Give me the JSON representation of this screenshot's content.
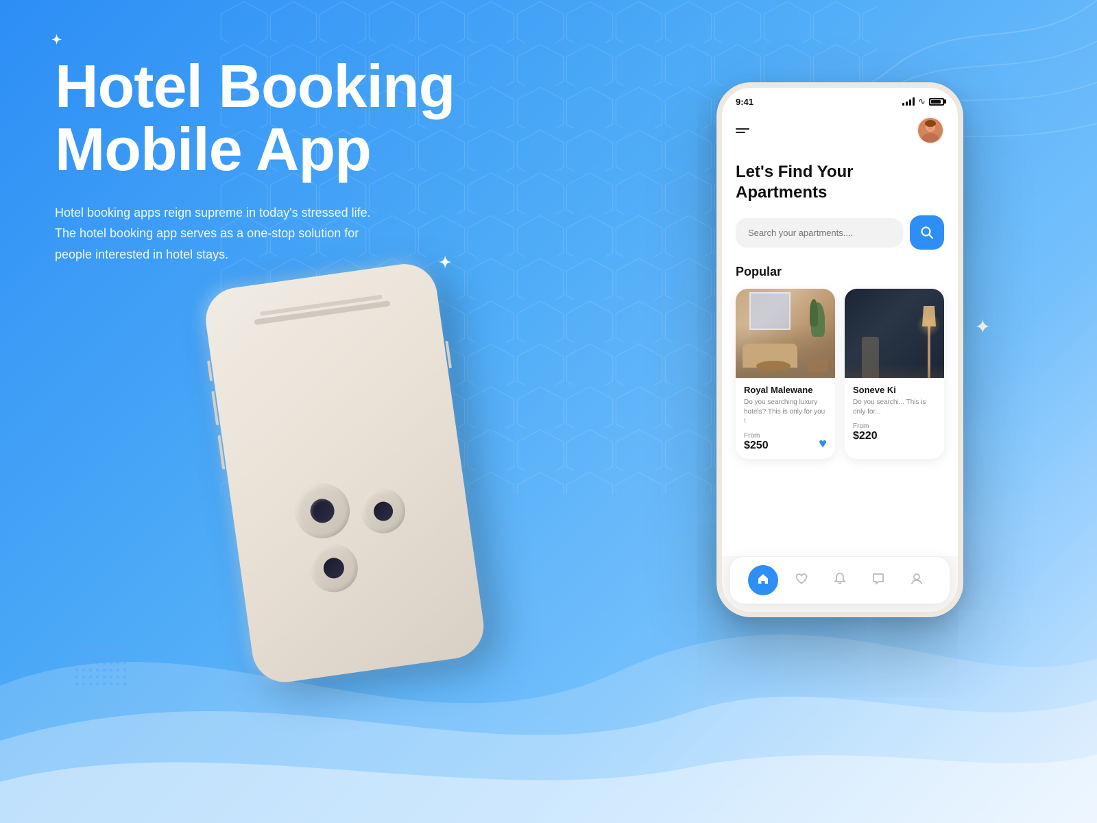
{
  "page": {
    "background": {
      "gradient_start": "#3399ff",
      "gradient_end": "#74c0fc"
    }
  },
  "left": {
    "title_line1": "Hotel Booking",
    "title_line2": "Mobile App",
    "subtitle": "Hotel booking apps reign supreme in today's stressed life. The hotel booking app serves as a one-stop solution for people interested in hotel stays."
  },
  "phone": {
    "status_bar": {
      "time": "9:41"
    },
    "header": {
      "menu_label": "menu"
    },
    "find_title": "Let's Find Your Apartments",
    "search": {
      "placeholder": "Search your apartments....",
      "button_label": "Search"
    },
    "popular": {
      "section_title": "Popular",
      "cards": [
        {
          "name": "Royal Malewane",
          "description": "Do you searching luxury hotels? This is only for you !",
          "from_label": "From",
          "price": "$250",
          "has_heart": true,
          "heart_filled": true
        },
        {
          "name": "Soneve Ki",
          "description": "Do you searchi... This is only for...",
          "from_label": "From",
          "price": "$220",
          "has_heart": false
        }
      ]
    },
    "bottom_nav": {
      "items": [
        {
          "icon": "home",
          "label": "Home",
          "active": true
        },
        {
          "icon": "heart",
          "label": "Favorites",
          "active": false
        },
        {
          "icon": "bell",
          "label": "Notifications",
          "active": false
        },
        {
          "icon": "chat",
          "label": "Messages",
          "active": false
        },
        {
          "icon": "user",
          "label": "Profile",
          "active": false
        }
      ]
    }
  },
  "decorations": {
    "sparkle_top": "✦",
    "sparkle_mid": "✦",
    "star_right": "✦"
  }
}
